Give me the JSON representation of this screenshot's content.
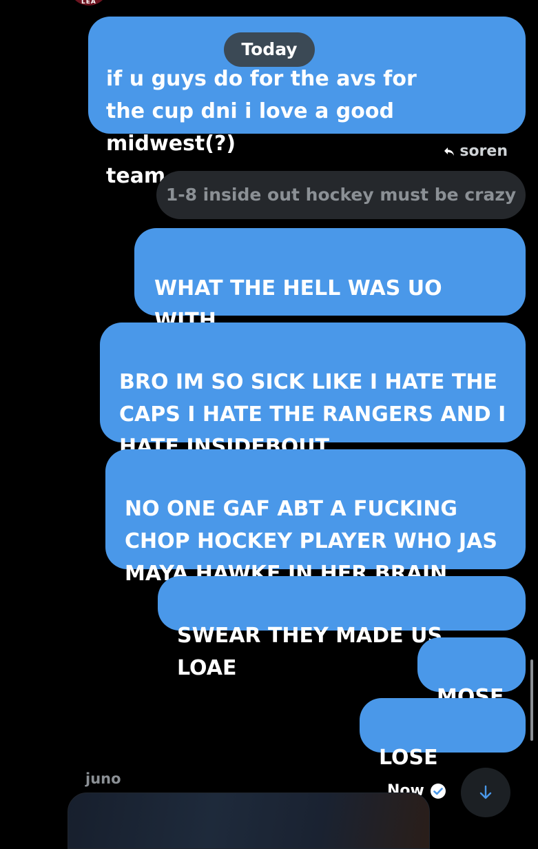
{
  "avatar": {
    "text": "LEA"
  },
  "date_divider": "Today",
  "messages": [
    {
      "text": "if u guys do              for the avs for\nthe cup dni i love a good midwest(?)\nteam"
    },
    {
      "text": "WHAT THE HELL WAS UO WITH\nTHAT"
    },
    {
      "text": "BRO IM SO SICK LIKE I HATE THE\nCAPS I HATE THE RANGERS AND I\nHATE INSIDEBOUT"
    },
    {
      "text": "NO ONE GAF ABT A FUCKING\nCHOP HOCKEY PLAYER WHO JAS\nMAYA HAWKE IN HER BRAIN"
    },
    {
      "text": "SWEAR THEY MADE US LOAE"
    },
    {
      "text": "MOSE"
    },
    {
      "text": "LOSE",
      "time": "Now"
    }
  ],
  "reply": {
    "to": "soren",
    "quoted_text": "1-8 inside out hockey must be crazy"
  },
  "next_sender": "juno",
  "colors": {
    "bubble": "#4a98e9",
    "quoted_bubble": "#25282c",
    "background": "#000000",
    "date_pill": "#3b4955"
  },
  "icons": {
    "reply": "reply-arrow-icon",
    "read": "check-circle-icon",
    "scroll": "arrow-down-icon"
  }
}
